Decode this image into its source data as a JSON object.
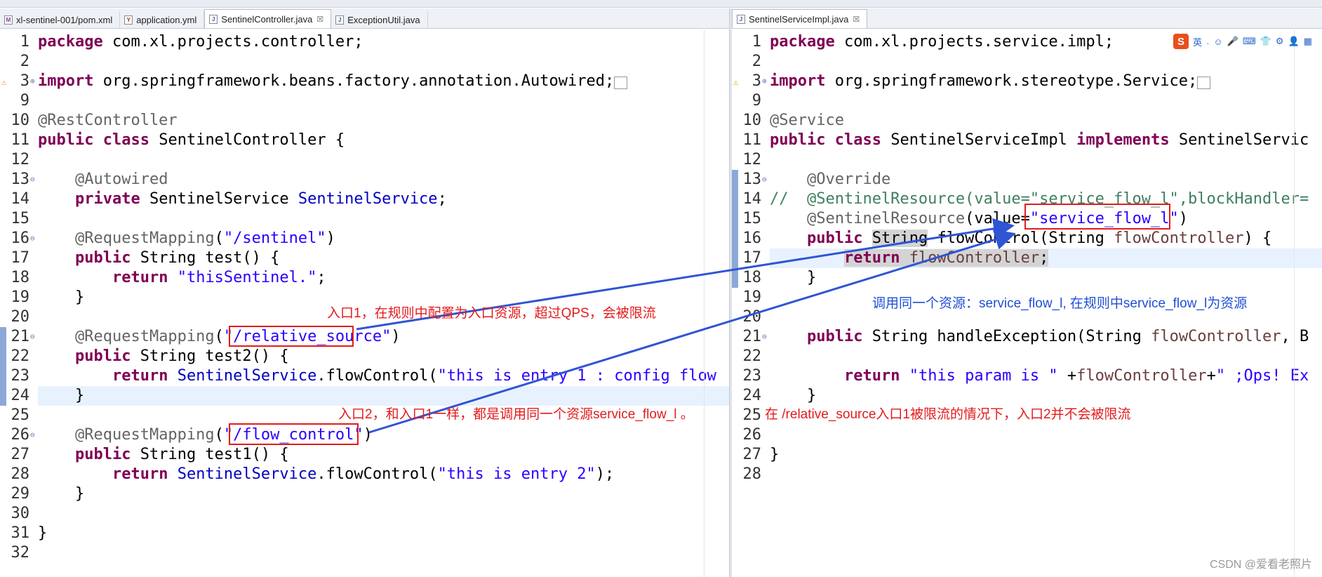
{
  "left_tabs": [
    {
      "label": "xl-sentinel-001/pom.xml",
      "icon": "xml-file-icon",
      "active": false
    },
    {
      "label": "application.yml",
      "icon": "yml-file-icon",
      "active": false
    },
    {
      "label": "SentinelController.java",
      "icon": "java-file-icon",
      "active": true
    },
    {
      "label": "ExceptionUtil.java",
      "icon": "java-file-icon",
      "active": false
    }
  ],
  "right_tabs": [
    {
      "label": "SentinelServiceImpl.java",
      "icon": "java-file-icon",
      "active": true
    }
  ],
  "close_glyph": "☒",
  "ime": {
    "logo": "S",
    "lang": "英",
    "items": [
      "˒",
      "☺",
      "🎤",
      "⌨",
      "👕",
      "⚙",
      "👤",
      "▦"
    ]
  },
  "left_code": [
    {
      "n": "1",
      "fold": "",
      "html": "<span class='kw'>package</span> com.xl.projects.controller;"
    },
    {
      "n": "2",
      "fold": "",
      "html": ""
    },
    {
      "n": "3",
      "fold": "⊕",
      "html": "<span class='kw'>import</span> org.springframework.beans.factory.annotation.Autowired;<span style='border:1px solid #999;font-size:14px;'>&nbsp;&nbsp;</span>"
    },
    {
      "n": "9",
      "fold": "",
      "html": ""
    },
    {
      "n": "10",
      "fold": "",
      "html": "<span class='ann'>@RestController</span>"
    },
    {
      "n": "11",
      "fold": "",
      "html": "<span class='kw'>public</span> <span class='kw'>class</span> SentinelController {"
    },
    {
      "n": "12",
      "fold": "",
      "html": ""
    },
    {
      "n": "13",
      "fold": "⊖",
      "html": "    <span class='ann'>@Autowired</span>"
    },
    {
      "n": "14",
      "fold": "",
      "html": "    <span class='kw'>private</span> SentinelService <span class='fld'>SentinelService</span>;"
    },
    {
      "n": "15",
      "fold": "",
      "html": ""
    },
    {
      "n": "16",
      "fold": "⊖",
      "html": "    <span class='ann'>@RequestMapping</span>(<span class='str'>\"/sentinel\"</span>)"
    },
    {
      "n": "17",
      "fold": "",
      "html": "    <span class='kw'>public</span> String test() {"
    },
    {
      "n": "18",
      "fold": "",
      "html": "        <span class='kw'>return</span> <span class='str'>\"thisSentinel.\"</span>;"
    },
    {
      "n": "19",
      "fold": "",
      "html": "    }"
    },
    {
      "n": "20",
      "fold": "",
      "html": ""
    },
    {
      "n": "21",
      "fold": "⊖",
      "html": "    <span class='ann'>@RequestMapping</span>(<span class='str'>\"/relative_source\"</span>)"
    },
    {
      "n": "22",
      "fold": "",
      "html": "    <span class='kw'>public</span> String test2() {"
    },
    {
      "n": "23",
      "fold": "",
      "html": "        <span class='kw'>return</span> <span class='fld'>SentinelService</span>.flowControl(<span class='str'>\"this is entry 1 : config flow</span>"
    },
    {
      "n": "24",
      "fold": "",
      "html": "    }"
    },
    {
      "n": "25",
      "fold": "",
      "html": ""
    },
    {
      "n": "26",
      "fold": "⊖",
      "html": "    <span class='ann'>@RequestMapping</span>(<span class='str'>\"/flow_control\"</span>)"
    },
    {
      "n": "27",
      "fold": "",
      "html": "    <span class='kw'>public</span> String test1() {"
    },
    {
      "n": "28",
      "fold": "",
      "html": "        <span class='kw'>return</span> <span class='fld'>SentinelService</span>.flowControl(<span class='str'>\"this is entry 2\"</span>);"
    },
    {
      "n": "29",
      "fold": "",
      "html": "    }"
    },
    {
      "n": "30",
      "fold": "",
      "html": ""
    },
    {
      "n": "31",
      "fold": "",
      "html": "}"
    },
    {
      "n": "32",
      "fold": "",
      "html": ""
    }
  ],
  "right_code": [
    {
      "n": "1",
      "fold": "",
      "html": "<span class='kw'>package</span> com.xl.projects.service.impl;"
    },
    {
      "n": "2",
      "fold": "",
      "html": ""
    },
    {
      "n": "3",
      "fold": "⊕",
      "html": "<span class='kw'>import</span> org.springframework.stereotype.Service;<span style='border:1px solid #999;font-size:14px;'>&nbsp;&nbsp;</span>"
    },
    {
      "n": "9",
      "fold": "",
      "html": ""
    },
    {
      "n": "10",
      "fold": "",
      "html": "<span class='ann'>@Service</span>"
    },
    {
      "n": "11",
      "fold": "",
      "html": "<span class='kw'>public</span> <span class='kw'>class</span> SentinelServiceImpl <span class='kw'>implements</span> SentinelServic"
    },
    {
      "n": "12",
      "fold": "",
      "html": ""
    },
    {
      "n": "13",
      "fold": "⊖",
      "html": "    <span class='ann'>@Override</span>"
    },
    {
      "n": "14",
      "fold": "",
      "html": "<span class='cmt'>//  @SentinelResource(value=\"service_flow_l\",blockHandler=</span>"
    },
    {
      "n": "15",
      "fold": "",
      "html": "    <span class='ann'>@SentinelResource</span>(value=<span class='str'>\"service_flow_l\"</span>)"
    },
    {
      "n": "16",
      "fold": "",
      "html": "    <span class='kw'>public</span> <span style='background:#d4d4d4'>String</span> flowControl(String <span class='var'>flowController</span>) {"
    },
    {
      "n": "17",
      "fold": "",
      "html": "        <span style='background:#d4d4d4'><span class='kw'>return</span> <span class='var'>flowController</span>;</span>"
    },
    {
      "n": "18",
      "fold": "",
      "html": "    }"
    },
    {
      "n": "19",
      "fold": "",
      "html": ""
    },
    {
      "n": "20",
      "fold": "",
      "html": ""
    },
    {
      "n": "21",
      "fold": "⊖",
      "html": "    <span class='kw'>public</span> String handleException(String <span class='var'>flowController</span>, B"
    },
    {
      "n": "22",
      "fold": "",
      "html": ""
    },
    {
      "n": "23",
      "fold": "",
      "html": "        <span class='kw'>return</span> <span class='str'>\"this param is \"</span> +<span class='var'>flowController</span>+<span class='str'>\" ;Ops! Ex</span>"
    },
    {
      "n": "24",
      "fold": "",
      "html": "    }"
    },
    {
      "n": "25",
      "fold": "",
      "html": ""
    },
    {
      "n": "26",
      "fold": "",
      "html": ""
    },
    {
      "n": "27",
      "fold": "",
      "html": "}"
    },
    {
      "n": "28",
      "fold": "",
      "html": ""
    }
  ],
  "annotations": {
    "note1": "入口1，在规则中配置为入口资源，超过QPS，会被限流",
    "note2": "入口2，和入口1一样，都是调用同一个资源service_flow_l 。",
    "note3": "调用同一个资源：service_flow_l, 在规则中service_flow_l为资源",
    "note4": "在  /relative_source入口1被限流的情况下，入口2并不会被限流"
  },
  "watermark": "CSDN @爱看老照片"
}
